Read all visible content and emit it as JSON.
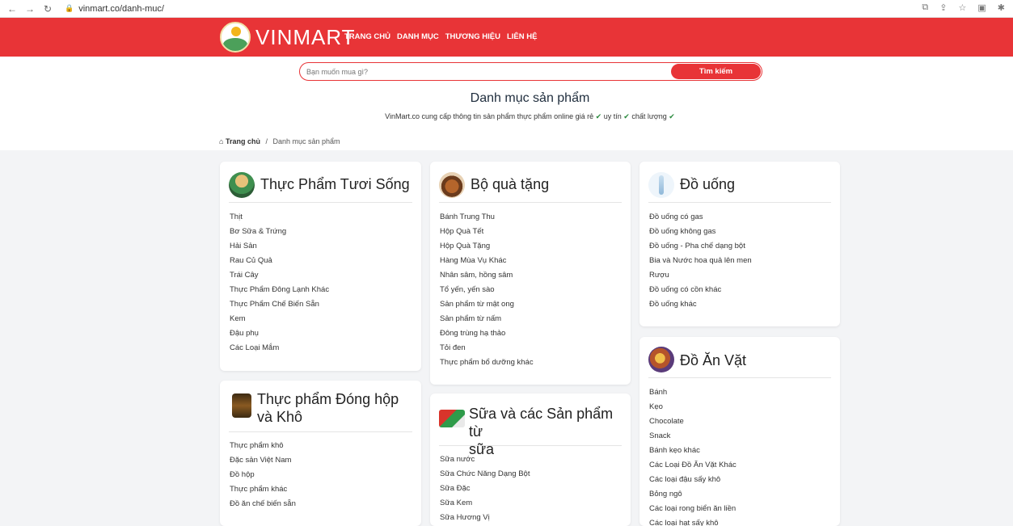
{
  "browser": {
    "url": "vinmart.co/danh-muc/"
  },
  "header": {
    "brand": "VINMART",
    "nav": [
      "TRANG CHỦ",
      "DANH MỤC",
      "THƯƠNG HIỆU",
      "LIÊN HỆ"
    ]
  },
  "search": {
    "placeholder": "Bạn muốn mua gì?",
    "button": "Tìm kiếm"
  },
  "page": {
    "title": "Danh mục sản phẩm",
    "subtitle_parts": [
      "VinMart.co cung cấp thông tin sản phẩm thực phẩm online giá rẻ",
      "uy tín",
      "chất lượng"
    ]
  },
  "breadcrumb": {
    "home": "Trang chủ",
    "separator": "/",
    "current": "Danh mục sản phẩm"
  },
  "colors": {
    "brand_red": "#e83437",
    "check_green": "#2b8a3e"
  },
  "cards": [
    {
      "title": "Thực Phẩm Tươi Sống",
      "icon": "fresh-food-icon",
      "items": [
        "Thịt",
        "Bơ Sữa & Trứng",
        "Hải Sản",
        "Rau Củ Quả",
        "Trái Cây",
        "Thực Phẩm Đông Lạnh Khác",
        "Thực Phẩm Chế Biến Sẵn",
        "Kem",
        "Đậu phụ",
        "Các Loại Mắm"
      ]
    },
    {
      "title": "Bộ quà tặng",
      "icon": "gift-set-icon",
      "items": [
        "Bánh Trung Thu",
        "Hộp Quà Tết",
        "Hộp Quà Tặng",
        "Hàng Mùa Vụ Khác",
        "Nhân sâm, hồng sâm",
        "Tổ yến, yến sào",
        "Sản phẩm từ mật ong",
        "Sản phẩm từ nấm",
        "Đông trùng hạ thảo",
        "Tỏi đen",
        "Thực phẩm bổ dưỡng khác"
      ]
    },
    {
      "title": "Đồ uống",
      "icon": "drink-bottle-icon",
      "items": [
        "Đồ uống có gas",
        "Đồ uống không gas",
        "Đồ uống - Pha chế dạng bột",
        "Bia và Nước hoa quả lên men",
        "Rượu",
        "Đồ uống có cồn khác",
        "Đồ uống khác"
      ]
    },
    {
      "title_lines": [
        "Thực phẩm Đóng hộp",
        "và Khô"
      ],
      "icon": "canned-food-icon",
      "items": [
        "Thực phẩm khô",
        "Đặc sản Việt Nam",
        "Đồ hộp",
        "Thực phẩm khác",
        "Đồ ăn chế biến sẵn"
      ]
    },
    {
      "title_lines": [
        "Sữa và các Sản phẩm từ",
        "sữa"
      ],
      "icon": "milk-product-icon",
      "items": [
        "Sữa nước",
        "Sữa Chức Năng Dạng Bột",
        "Sữa Đặc",
        "Sữa Kem",
        "Sữa Hương Vị"
      ]
    },
    {
      "title": "Đồ Ăn Vặt",
      "icon": "snack-icon",
      "items": [
        "Bánh",
        "Kẹo",
        "Chocolate",
        "Snack",
        "Bánh kẹo khác",
        "Các Loại Đồ Ăn Vặt Khác",
        "Các loại đậu sấy khô",
        "Bỏng ngô",
        "Các loại rong biển ăn liền",
        "Các loại hạt sấy khô"
      ]
    }
  ]
}
